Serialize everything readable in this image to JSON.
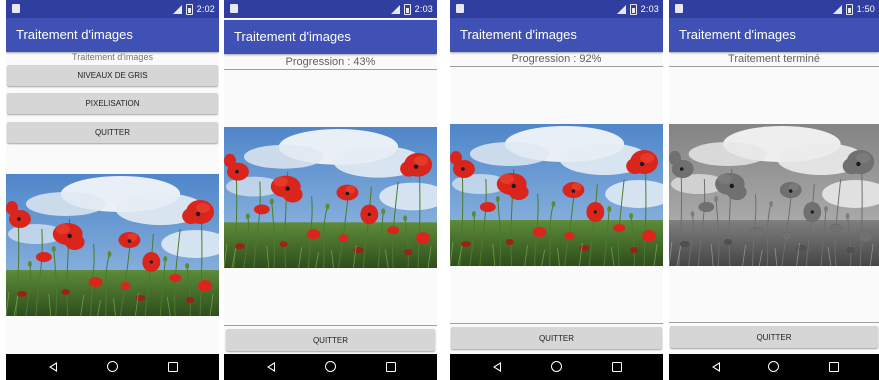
{
  "colors": {
    "status_bar": "#303f9f",
    "app_bar": "#3f51b5",
    "button": "#d6d6d6",
    "nav_bar": "#000000"
  },
  "icons": [
    "notification-icon",
    "signal-icon",
    "battery-icon",
    "back-icon",
    "home-icon",
    "recents-icon"
  ],
  "screens": [
    {
      "status_time": "2:02",
      "app_title": "Traitement d'images",
      "caption": "Traitement d'images",
      "buttons": [
        "NIVEAUX DE GRIS",
        "PIXELISATION",
        "QUITTER"
      ],
      "image": "Photo de coquelicots rouges sous un ciel bleu nuageux"
    },
    {
      "status_time": "2:03",
      "app_title": "Traitement d'images",
      "status_text": "Progression : 43%",
      "progress_percent": 43,
      "quit_label": "QUITTER",
      "image": "Photo de coquelicots rouges sous un ciel bleu nuageux"
    },
    {
      "status_time": "2:03",
      "app_title": "Traitement d'images",
      "status_text": "Progression : 92%",
      "progress_percent": 92,
      "quit_label": "QUITTER",
      "image": "Photo de coquelicots rouges sous un ciel bleu nuageux"
    },
    {
      "status_time": "1:50",
      "app_title": "Traitement d'images",
      "status_text": "Traitement terminé",
      "quit_label": "QUITTER",
      "image": "Photo de coquelicots en niveaux de gris"
    }
  ]
}
